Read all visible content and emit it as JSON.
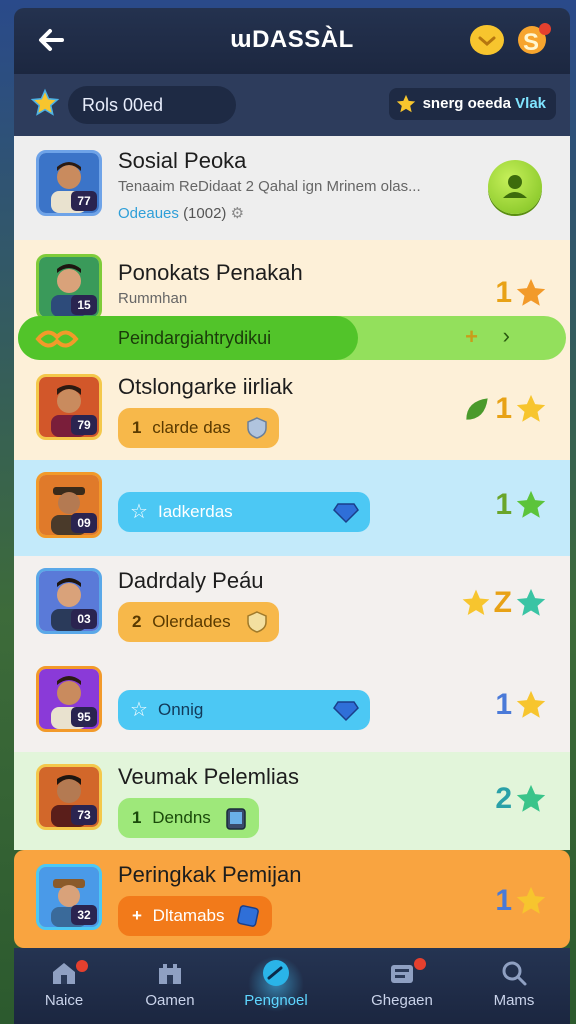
{
  "header": {
    "title": "ɯDASSÀL",
    "back_icon": "arrow-left-icon",
    "chat_icon": "chat-icon",
    "profile_icon": "profile-icon"
  },
  "subbar": {
    "rank_label": "Rols 00ed",
    "promo_text": "snerg oeeda",
    "promo_highlight": "Vlak"
  },
  "rows": [
    {
      "name": "Sosial Peoka",
      "subtitle": "Tenaaim ReDidaat 2 Qahal ign Mrinem olas...",
      "meta_label": "Odeaues",
      "meta_count": "(1002)",
      "level": "77",
      "bg": "#eeeeee"
    },
    {
      "name": "Ponokats Penakah",
      "subtitle": "Rummhan",
      "progress_label": "Peindargiahtrydikui",
      "progress_value": 0.62,
      "level": "15",
      "score": "1",
      "bg": "#fdf0d8"
    },
    {
      "name": "Otslongarke iirliak",
      "badge_num": "1",
      "badge_text": "clarde das",
      "level": "79",
      "score": "1",
      "bg": "#fdf0d8"
    },
    {
      "name": "",
      "badge_text": "Iadkerdas",
      "level": "09",
      "score": "1",
      "bg": "#c3eafa"
    },
    {
      "name": "Dadrdaly Peáu",
      "badge_num": "2",
      "badge_text": "Olerdades",
      "level": "03",
      "score": "Z",
      "bg": "#f3f0ee"
    },
    {
      "name": "",
      "badge_text": "Onnig",
      "level": "95",
      "score": "1",
      "bg": "#f3f0ee"
    },
    {
      "name": "Veumak Pelemlias",
      "badge_num": "1",
      "badge_text": "Dendns",
      "level": "73",
      "score": "2",
      "bg": "#e2f5da"
    },
    {
      "name": "Peringkak Pemijan",
      "badge_num": "+",
      "badge_text": "Dltamabs",
      "level": "32",
      "score": "1",
      "bg": "#f9a440"
    }
  ],
  "nav": [
    {
      "label": "Naice",
      "icon": "home-icon"
    },
    {
      "label": "Oamen",
      "icon": "castle-icon"
    },
    {
      "label": "Pengnoel",
      "icon": "leaderboard-icon",
      "active": true
    },
    {
      "label": "Ghegaen",
      "icon": "inbox-icon"
    },
    {
      "label": "Mams",
      "icon": "search-icon"
    }
  ],
  "colors": {
    "accent": "#5fd6ff",
    "green_badge": "#7fdc45",
    "orange_badge": "#f7b84a",
    "blue_badge": "#4cc8f4",
    "star": "#f7c52e"
  }
}
